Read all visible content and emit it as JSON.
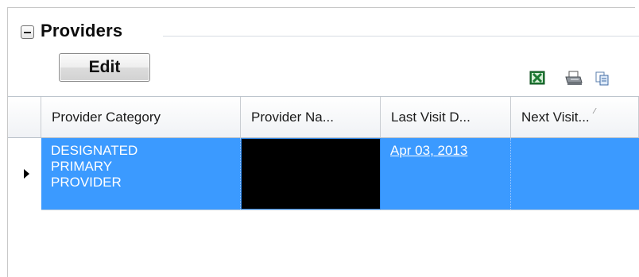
{
  "group": {
    "collapse_symbol": "−",
    "title": "Providers"
  },
  "toolbar": {
    "edit_label": "Edit",
    "icons": [
      "excel-export-icon",
      "print-icon",
      "copy-icon"
    ]
  },
  "grid": {
    "columns": [
      "Provider Category",
      "Provider Na...",
      "Last Visit D...",
      "Next Visit..."
    ],
    "rows": [
      {
        "provider_category_lines": [
          "DESIGNATED",
          "PRIMARY",
          "PROVIDER"
        ],
        "provider_name": "",
        "last_visit_date": "Apr 03, 2013",
        "next_visit_date": ""
      }
    ],
    "selected_row_color": "#3b9aff"
  }
}
